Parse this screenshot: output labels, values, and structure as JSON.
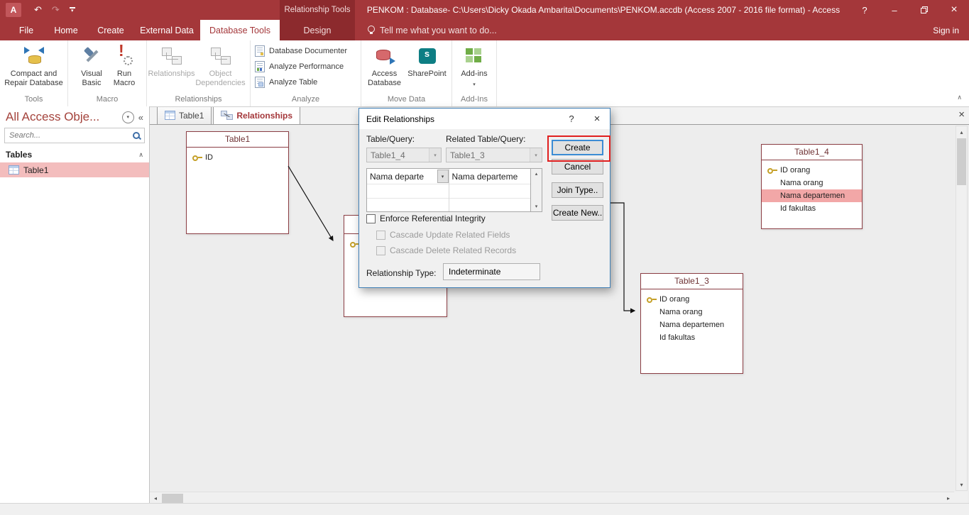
{
  "colors": {
    "accent": "#A4373A",
    "contextual_dark": "#8C2A2D",
    "nav_selection_pink": "#F3BDBD",
    "field_highlight_pink": "#F2A7A7",
    "annotation_red": "#E01F1F",
    "table_box_border": "#8B3E44"
  },
  "icons": {
    "undo": "↶",
    "redo": "↷",
    "dropdown": "▾",
    "up_arrow": "▴",
    "down_arrow": "▾",
    "left_arrow": "◂",
    "right_arrow": "▸",
    "collapse": "∧",
    "chevrons_left": "«",
    "help": "?",
    "minimize": "–",
    "close": "×",
    "app_letter": "A"
  },
  "titlebar": {
    "app_title": "PENKOM : Database- C:\\Users\\Dicky Okada Ambarita\\Documents\\PENKOM.accdb (Access 2007 - 2016 file format) - Access",
    "contextual_label": "Relationship Tools",
    "sign_in": "Sign in"
  },
  "ribbon": {
    "tabs": [
      "File",
      "Home",
      "Create",
      "External Data",
      "Database Tools",
      "Design"
    ],
    "tell_me": "Tell me what you want to do...",
    "groups": {
      "tools": {
        "label": "Tools",
        "buttons": [
          "Compact and Repair Database"
        ]
      },
      "macro": {
        "label": "Macro",
        "buttons": [
          "Visual Basic",
          "Run Macro"
        ]
      },
      "relationships": {
        "label": "Relationships",
        "buttons": [
          "Relationships",
          "Object Dependencies"
        ]
      },
      "analyze": {
        "label": "Analyze",
        "items": [
          "Database Documenter",
          "Analyze Performance",
          "Analyze Table"
        ]
      },
      "move_data": {
        "label": "Move Data",
        "buttons": [
          "Access Database",
          "SharePoint"
        ]
      },
      "addins": {
        "label": "Add-Ins",
        "buttons": [
          "Add-ins"
        ]
      }
    }
  },
  "nav": {
    "title": "All Access Obje...",
    "search_placeholder": "Search...",
    "section": "Tables",
    "items": [
      "Table1"
    ]
  },
  "workspace": {
    "doc_tabs": [
      "Table1",
      "Relationships"
    ]
  },
  "diagram": {
    "table1": {
      "title": "Table1",
      "fields": [
        "ID"
      ]
    },
    "table1_3": {
      "title": "Table1_3",
      "fields": [
        "ID orang",
        "Nama orang",
        "Nama departemen",
        "Id fakultas"
      ]
    },
    "table1_4": {
      "title": "Table1_4",
      "fields": [
        "ID orang",
        "Nama orang",
        "Nama departemen",
        "Id fakultas"
      ]
    }
  },
  "dialog": {
    "title": "Edit Relationships",
    "table_query_label": "Table/Query:",
    "related_table_query_label": "Related Table/Query:",
    "table_query_value": "Table1_4",
    "related_table_query_value": "Table1_3",
    "grid": {
      "left_value": "Nama departe",
      "right_value": "Nama departeme"
    },
    "enforce_label": "Enforce Referential Integrity",
    "cascade_update_label": "Cascade Update Related Fields",
    "cascade_delete_label": "Cascade Delete Related Records",
    "relationship_type_label": "Relationship Type:",
    "relationship_type_value": "Indeterminate",
    "buttons": {
      "create": "Create",
      "cancel": "Cancel",
      "join_type": "Join Type..",
      "create_new": "Create New.."
    }
  }
}
